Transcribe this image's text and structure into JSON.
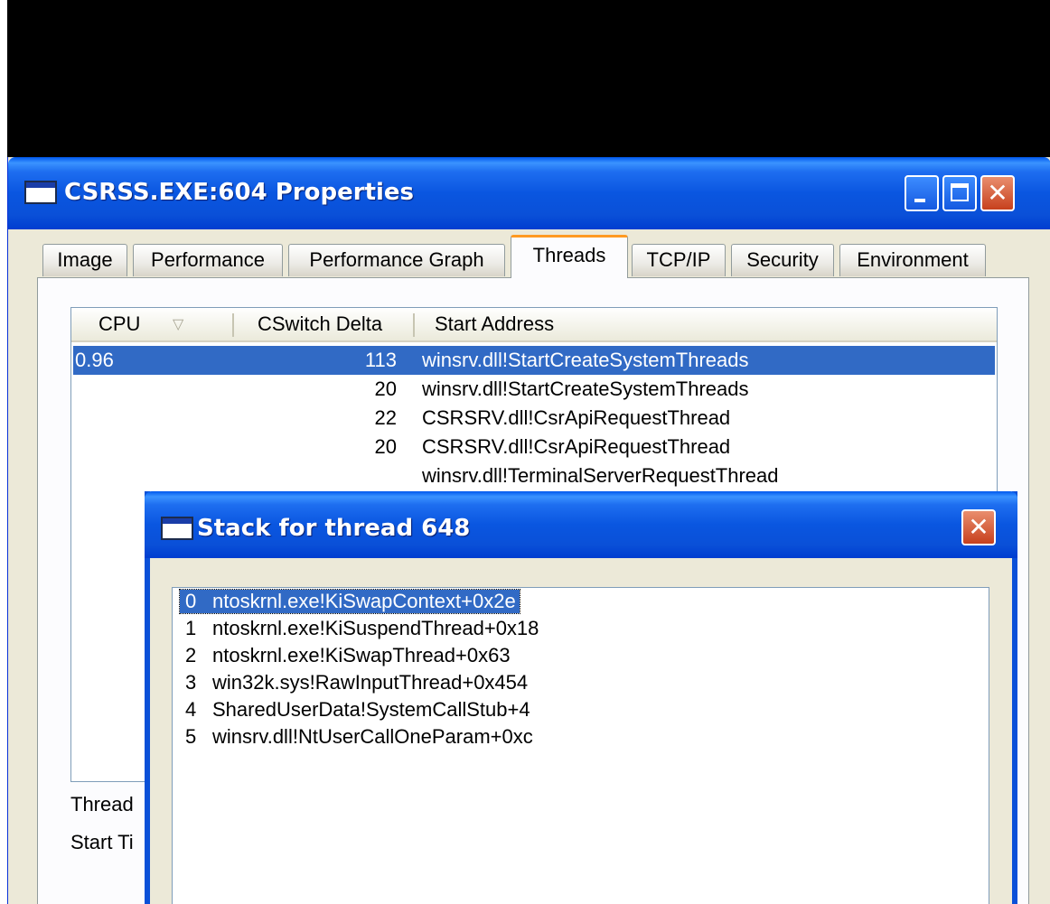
{
  "main_window": {
    "title": "CSRSS.EXE:604 Properties",
    "tabs": [
      {
        "label": "Image"
      },
      {
        "label": "Performance"
      },
      {
        "label": "Performance Graph"
      },
      {
        "label": "Threads",
        "active": true
      },
      {
        "label": "TCP/IP"
      },
      {
        "label": "Security"
      },
      {
        "label": "Environment"
      }
    ],
    "threads_list": {
      "columns": [
        "CPU",
        "CSwitch Delta",
        "Start Address"
      ],
      "sort_column": "CPU",
      "rows": [
        {
          "cpu": "0.96",
          "cswitch": "113",
          "address": "winsrv.dll!StartCreateSystemThreads",
          "selected": true
        },
        {
          "cpu": "",
          "cswitch": "20",
          "address": "winsrv.dll!StartCreateSystemThreads"
        },
        {
          "cpu": "",
          "cswitch": "22",
          "address": "CSRSRV.dll!CsrApiRequestThread"
        },
        {
          "cpu": "",
          "cswitch": "20",
          "address": "CSRSRV.dll!CsrApiRequestThread"
        },
        {
          "cpu": "",
          "cswitch": "",
          "address": "winsrv.dll!TerminalServerRequestThread"
        }
      ]
    },
    "labels": {
      "thread": "Thread",
      "start_time": "Start Ti"
    }
  },
  "stack_dialog": {
    "title": "Stack for thread 648",
    "frames": [
      {
        "index": "0",
        "frame": "ntoskrnl.exe!KiSwapContext+0x2e",
        "selected": true
      },
      {
        "index": "1",
        "frame": "ntoskrnl.exe!KiSuspendThread+0x18"
      },
      {
        "index": "2",
        "frame": "ntoskrnl.exe!KiSwapThread+0x63"
      },
      {
        "index": "3",
        "frame": "win32k.sys!RawInputThread+0x454"
      },
      {
        "index": "4",
        "frame": "SharedUserData!SystemCallStub+4"
      },
      {
        "index": "5",
        "frame": "winsrv.dll!NtUserCallOneParam+0xc"
      }
    ]
  },
  "colors": {
    "titlebar_blue": "#0A56E0",
    "selection_blue": "#316AC5",
    "window_face": "#ECE9D8",
    "close_red": "#C7401D",
    "active_tab_accent": "#FF9A22"
  }
}
